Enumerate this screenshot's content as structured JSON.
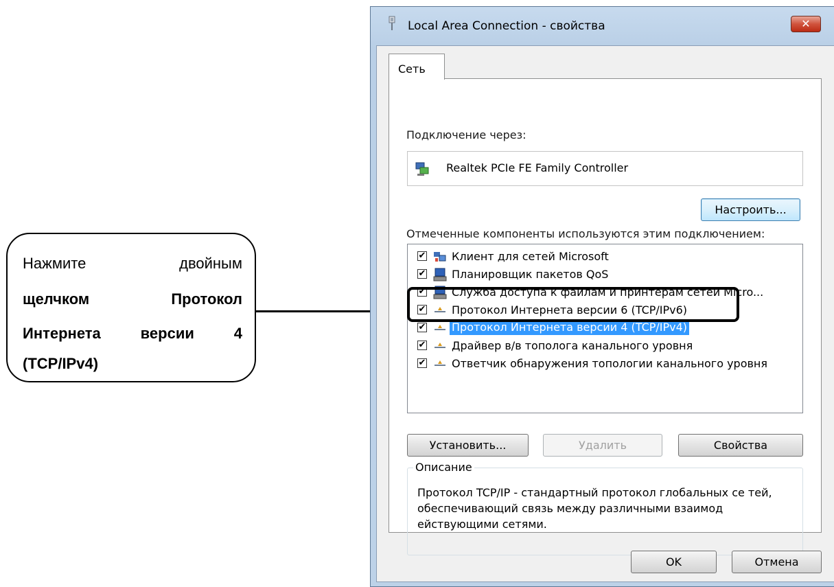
{
  "callout": {
    "line1_word1": "Нажмите",
    "line1_word2": "двойным",
    "line2_word1": "щелчком",
    "line2_word2": "Протокол",
    "line3_word1": "Интернета",
    "line3_word2": "версии",
    "line3_word3": "4",
    "line4": "(TCP/IPv4)"
  },
  "window": {
    "title": "Local Area Connection - свойства",
    "close_glyph": "✕"
  },
  "tabs": [
    {
      "label": "Сеть"
    }
  ],
  "connect_via_label": "Подключение через:",
  "adapter_name": "Realtek PCIe FE Family Controller",
  "configure_button": "Настроить...",
  "components_label": "Отмеченные компоненты используются этим подключением:",
  "components": [
    {
      "label": "Клиент для сетей Microsoft",
      "checked": true,
      "icon": "network-client-icon"
    },
    {
      "label": "Планировщик пакетов QoS",
      "checked": true,
      "icon": "computer-service-icon"
    },
    {
      "label": "Служба доступа к файлам и принтерам сетей Micro...",
      "checked": true,
      "icon": "computer-service-icon"
    },
    {
      "label": "Протокол Интернета версии 6 (TCP/IPv6)",
      "checked": true,
      "icon": "protocol-icon"
    },
    {
      "label": "Протокол Интернета версии 4 (TCP/IPv4)",
      "checked": true,
      "icon": "protocol-icon",
      "selected": true
    },
    {
      "label": "Драйвер в/в тополога канального уровня",
      "checked": true,
      "icon": "protocol-icon"
    },
    {
      "label": "Ответчик обнаружения топологии канального уровня",
      "checked": true,
      "icon": "protocol-icon"
    }
  ],
  "check_glyph": "✔",
  "buttons": {
    "install": "Установить...",
    "remove": "Удалить",
    "properties": "Свойства",
    "ok": "OK",
    "cancel": "Отмена"
  },
  "description": {
    "title": "Описание",
    "text": "Протокол TCP/IP - стандартный протокол глобальных се тей, обеспечивающий связь между различными взаимод ействующими сетями."
  }
}
